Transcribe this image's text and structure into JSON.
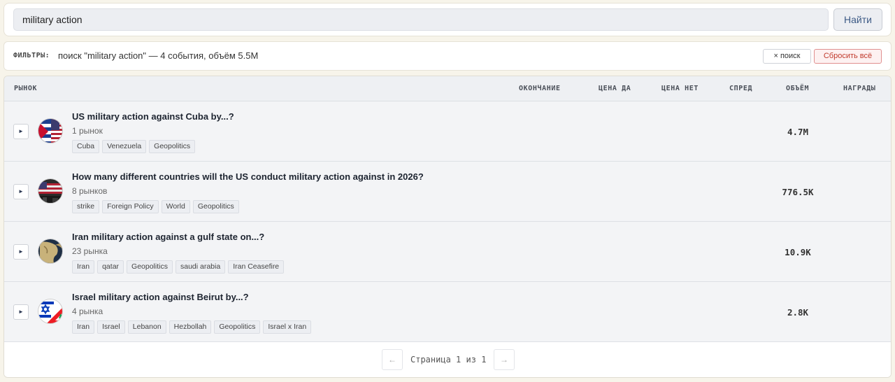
{
  "search": {
    "value": "military action",
    "button_label": "Найти"
  },
  "filters": {
    "label": "ФИЛЬТРЫ:",
    "summary": "поиск \"military action\" — 4 события, объём 5.5M",
    "clear_search_label": "× поиск",
    "reset_all_label": "Сбросить всё"
  },
  "table": {
    "columns": {
      "market": "РЫНОК",
      "end": "ОКОНЧАНИЕ",
      "price_yes": "ЦЕНА ДА",
      "price_no": "ЦЕНА НЕТ",
      "spread": "СПРЕД",
      "volume": "ОБЪЁМ",
      "rewards": "НАГРАДЫ"
    },
    "rows": [
      {
        "expand_glyph": "►",
        "title": "US military action against Cuba by...?",
        "count": "1 рынок",
        "tags": [
          "Cuba",
          "Venezuela",
          "Geopolitics"
        ],
        "volume": "4.7M",
        "icon": "cuba-us-flags-icon"
      },
      {
        "expand_glyph": "►",
        "title": "How many different countries will the US conduct military action against in 2026?",
        "count": "8 рынков",
        "tags": [
          "strike",
          "Foreign Policy",
          "World",
          "Geopolitics"
        ],
        "volume": "776.5K",
        "icon": "us-flag-military-icon"
      },
      {
        "expand_glyph": "►",
        "title": "Iran military action against a gulf state on...?",
        "count": "23 рынка",
        "tags": [
          "Iran",
          "qatar",
          "Geopolitics",
          "saudi arabia",
          "Iran Ceasefire"
        ],
        "volume": "10.9K",
        "icon": "gulf-map-icon"
      },
      {
        "expand_glyph": "►",
        "title": "Israel military action against Beirut by...?",
        "count": "4 рынка",
        "tags": [
          "Iran",
          "Israel",
          "Lebanon",
          "Hezbollah",
          "Geopolitics",
          "Israel x Iran"
        ],
        "volume": "2.8K",
        "icon": "israel-lebanon-flags-icon"
      }
    ]
  },
  "pagination": {
    "prev_label": "←",
    "next_label": "→",
    "page_word": "Страница",
    "current": "1",
    "of_word": "из",
    "total": "1"
  }
}
